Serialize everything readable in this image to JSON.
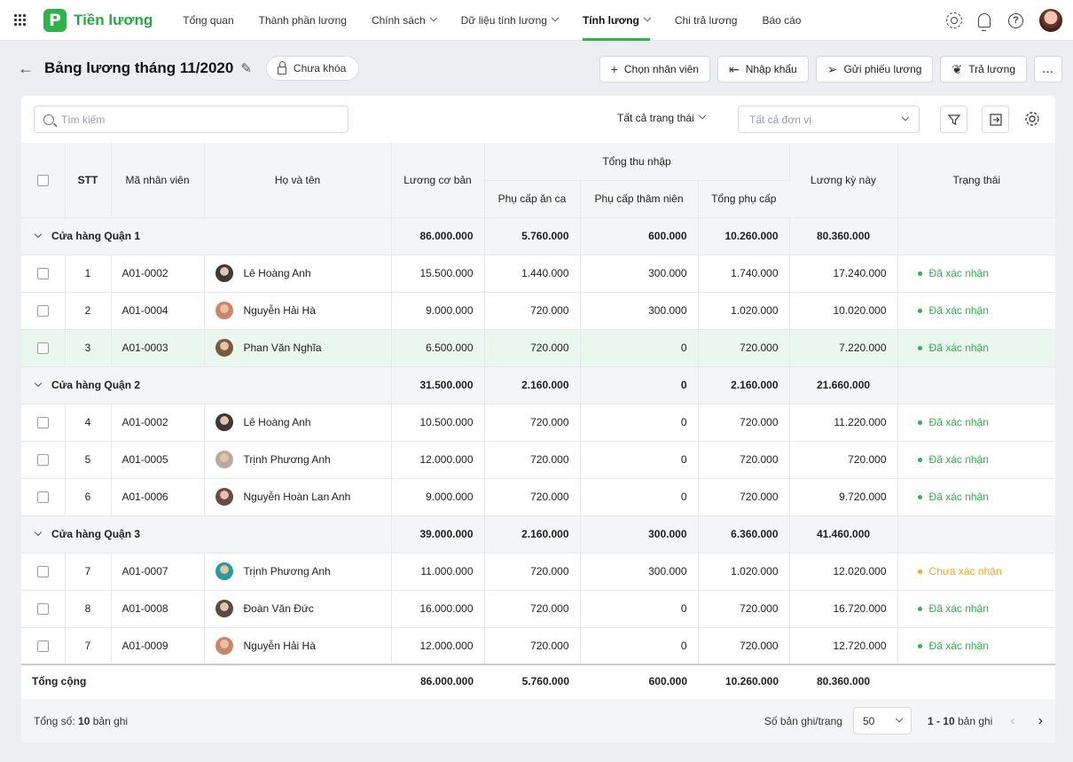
{
  "app": {
    "logo_letter": "P",
    "name": "Tiền lương",
    "accent": "#2db34a"
  },
  "nav": [
    {
      "label": "Tổng quan",
      "dropdown": false,
      "active": false
    },
    {
      "label": "Thành phần lương",
      "dropdown": false,
      "active": false
    },
    {
      "label": "Chính sách",
      "dropdown": true,
      "active": false
    },
    {
      "label": "Dữ liệu tính lương",
      "dropdown": true,
      "active": false
    },
    {
      "label": "Tính lương",
      "dropdown": true,
      "active": true
    },
    {
      "label": "Chi trả lương",
      "dropdown": false,
      "active": false
    },
    {
      "label": "Báo cáo",
      "dropdown": false,
      "active": false
    }
  ],
  "header": {
    "title": "Bảng lương tháng 11/2020",
    "lock_status": "Chưa khóa",
    "actions": {
      "choose_employee": "Chọn nhân viên",
      "import": "Nhập khẩu",
      "send_payslip": "Gửi phiếu lương",
      "pay": "Trả lương",
      "more": "..."
    }
  },
  "toolbar": {
    "search_placeholder": "Tìm kiếm",
    "status_filter": "Tất cả trạng thái",
    "unit_placeholder": "Tất cả đơn vị"
  },
  "table": {
    "headers": {
      "stt": "STT",
      "code": "Mã nhân viên",
      "name": "Họ và tên",
      "base": "Lương cơ bản",
      "income_group": "Tổng thu nhập",
      "meal": "Phụ cấp ăn ca",
      "seniority": "Phụ cấp thâm niên",
      "total_allowance": "Tổng phụ cấp",
      "period_salary": "Lương kỳ này",
      "status": "Trạng thái"
    },
    "groups": [
      {
        "name": "Cửa hàng Quận 1",
        "base": "86.000.000",
        "meal": "5.760.000",
        "seniority": "600.000",
        "total_allowance": "10.260.000",
        "period_salary": "80.360.000",
        "rows": [
          {
            "stt": "1",
            "code": "A01-0002",
            "name": "Lê Hoàng Anh",
            "avatar": "#3a3a3a",
            "base": "15.500.000",
            "meal": "1.440.000",
            "seniority": "300.000",
            "total_allowance": "1.740.000",
            "period_salary": "17.240.000",
            "status": "Đã xác nhận",
            "status_color": "#2db34a",
            "highlight": false
          },
          {
            "stt": "2",
            "code": "A01-0004",
            "name": "Nguyễn Hải Hà",
            "avatar": "#c9866b",
            "base": "9.000.000",
            "meal": "720.000",
            "seniority": "300.000",
            "total_allowance": "1.020.000",
            "period_salary": "10.020.000",
            "status": "Đã xác nhận",
            "status_color": "#2db34a",
            "highlight": false
          },
          {
            "stt": "3",
            "code": "A01-0003",
            "name": "Phan Văn Nghĩa",
            "avatar": "#7a5a3e",
            "base": "6.500.000",
            "meal": "720.000",
            "seniority": "0",
            "total_allowance": "720.000",
            "period_salary": "7.220.000",
            "status": "Đã xác nhận",
            "status_color": "#2db34a",
            "highlight": true
          }
        ]
      },
      {
        "name": "Cửa hàng Quận 2",
        "base": "31.500.000",
        "meal": "2.160.000",
        "seniority": "0",
        "total_allowance": "2.160.000",
        "period_salary": "21.660.000",
        "rows": [
          {
            "stt": "4",
            "code": "A01-0002",
            "name": "Lê Hoàng Anh",
            "avatar": "#3a3a3a",
            "base": "10.500.000",
            "meal": "720.000",
            "seniority": "0",
            "total_allowance": "720.000",
            "period_salary": "11.220.000",
            "status": "Đã xác nhận",
            "status_color": "#2db34a",
            "highlight": false
          },
          {
            "stt": "5",
            "code": "A01-0005",
            "name": "Trịnh Phương Anh",
            "avatar": "#b9aaa0",
            "base": "12.000.000",
            "meal": "720.000",
            "seniority": "0",
            "total_allowance": "720.000",
            "period_salary": "720.000",
            "status": "Đã xác nhận",
            "status_color": "#2db34a",
            "highlight": false
          },
          {
            "stt": "6",
            "code": "A01-0006",
            "name": "Nguyễn Hoàn Lan Anh",
            "avatar": "#6a4a45",
            "base": "9.000.000",
            "meal": "720.000",
            "seniority": "0",
            "total_allowance": "720.000",
            "period_salary": "9.720.000",
            "status": "Đã xác nhận",
            "status_color": "#2db34a",
            "highlight": false
          }
        ]
      },
      {
        "name": "Cửa hàng Quận 3",
        "base": "39.000.000",
        "meal": "2.160.000",
        "seniority": "300.000",
        "total_allowance": "6.360.000",
        "period_salary": "41.460.000",
        "rows": [
          {
            "stt": "7",
            "code": "A01-0007",
            "name": "Trịnh Phương Anh",
            "avatar": "#2a9a9a",
            "base": "11.000.000",
            "meal": "720.000",
            "seniority": "300.000",
            "total_allowance": "1.020.000",
            "period_salary": "12.020.000",
            "status": "Chưa xác nhận",
            "status_color": "#f5a623",
            "highlight": false
          },
          {
            "stt": "8",
            "code": "A01-0008",
            "name": "Đoàn Văn Đức",
            "avatar": "#5a4a44",
            "base": "16.000.000",
            "meal": "720.000",
            "seniority": "0",
            "total_allowance": "720.000",
            "period_salary": "16.720.000",
            "status": "Đã xác nhận",
            "status_color": "#2db34a",
            "highlight": false
          },
          {
            "stt": "7",
            "code": "A01-0009",
            "name": "Nguyễn Hải Hà",
            "avatar": "#c9866b",
            "base": "12.000.000",
            "meal": "720.000",
            "seniority": "0",
            "total_allowance": "720.000",
            "period_salary": "12.720.000",
            "status": "Đã xác nhận",
            "status_color": "#2db34a",
            "highlight": false
          }
        ]
      }
    ],
    "total": {
      "label": "Tổng cộng",
      "base": "86.000.000",
      "meal": "5.760.000",
      "seniority": "600.000",
      "total_allowance": "10.260.000",
      "period_salary": "80.360.000"
    }
  },
  "footer": {
    "total_label": "Tổng số: ",
    "total_count": "10",
    "total_suffix": " bản ghi",
    "per_page_label": "Số bản ghi/trang",
    "per_page": "50",
    "range": "1 - 10",
    "range_suffix": " bản ghi"
  }
}
